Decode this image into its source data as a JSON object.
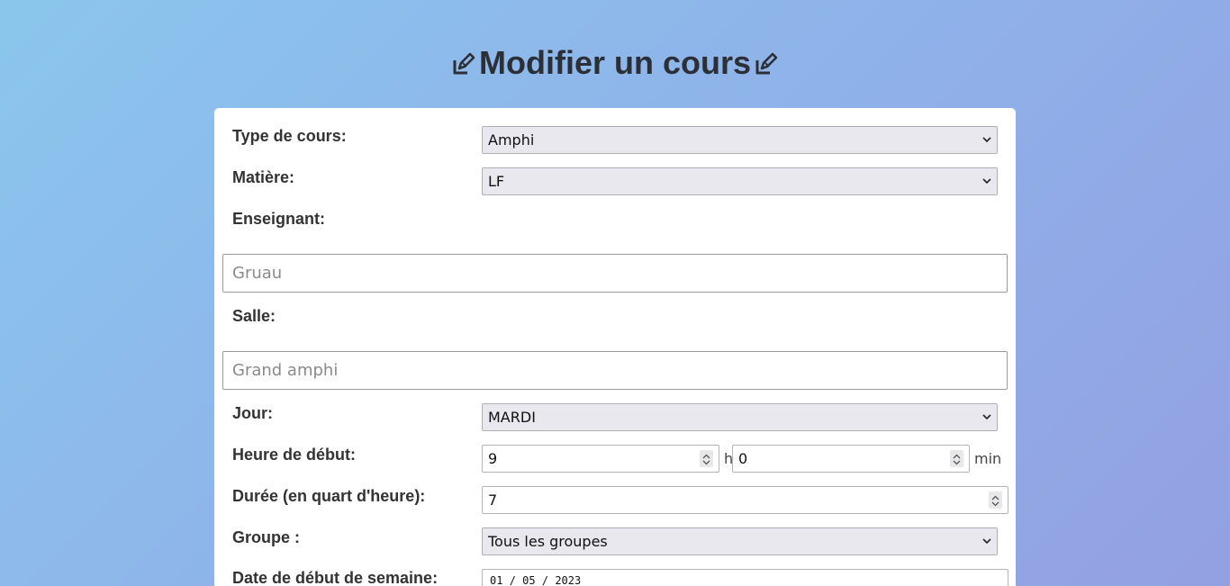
{
  "page": {
    "title": "Modifier un cours",
    "title_icon": "edit-memo-icon"
  },
  "form": {
    "course_type": {
      "label": "Type de cours:",
      "value": "Amphi"
    },
    "subject": {
      "label": "Matière:",
      "value": "LF"
    },
    "teacher": {
      "label": "Enseignant:",
      "placeholder": "Gruau"
    },
    "room": {
      "label": "Salle:",
      "placeholder": "Grand amphi"
    },
    "day": {
      "label": "Jour:",
      "value": "MARDI"
    },
    "start_time": {
      "label": "Heure de début:",
      "hours": "9",
      "hours_unit": "h",
      "minutes": "0",
      "minutes_unit": "min"
    },
    "duration": {
      "label": "Durée (en quart d'heure):",
      "value": "7"
    },
    "group": {
      "label": "Groupe :",
      "value": "Tous les groupes"
    },
    "week_start": {
      "label": "Date de début de semaine:",
      "day": "01",
      "month": "05",
      "year": "2023",
      "separator": "/"
    }
  },
  "colors": {
    "background_start": "#8ac6ec",
    "background_end": "#93a0e2",
    "card": "#ffffff",
    "select_bg": "#e8e8ee"
  }
}
